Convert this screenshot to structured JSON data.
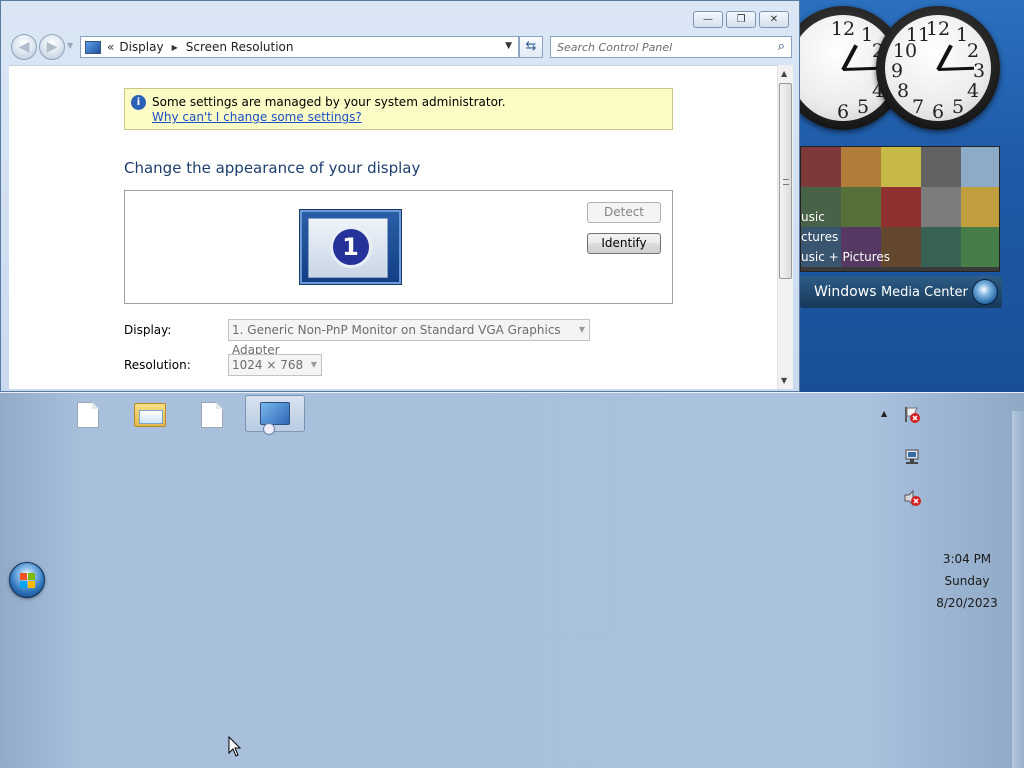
{
  "window": {
    "address": {
      "overflow": "«",
      "crumbs": [
        "Display",
        "Screen Resolution"
      ]
    },
    "search_placeholder": "Search Control Panel",
    "caption": {
      "minimize": "—",
      "restore": "❐",
      "close": "✕"
    },
    "infobar": {
      "message": "Some settings are managed by your system administrator.",
      "link": "Why can't I change some settings?"
    },
    "heading": "Change the appearance of your display",
    "monitor_number": "1",
    "buttons": {
      "detect": "Detect",
      "identify": "Identify"
    },
    "display": {
      "label": "Display:",
      "value": "1. Generic Non-PnP Monitor on Standard VGA Graphics Adapter"
    },
    "resolution": {
      "label": "Resolution:",
      "value": "1024 × 768"
    }
  },
  "gadgets": {
    "clock_numbers": [
      "12",
      "1",
      "2",
      "3",
      "4",
      "5",
      "6",
      "7",
      "8",
      "9",
      "10",
      "11"
    ],
    "media_center": {
      "labels": [
        "usic",
        "ctures",
        "usic + Pictures"
      ],
      "title_prefix": "Windows",
      "title_suffix": "Media Center"
    }
  },
  "taskbar": {
    "items": [
      "document",
      "explorer-folder",
      "document",
      "control-panel"
    ],
    "clock": {
      "time": "3:04 PM",
      "day": "Sunday",
      "date": "8/20/2023"
    }
  },
  "icons": {
    "info": "i",
    "refresh": "⇆",
    "search": "⌕",
    "tray_up": "▲"
  }
}
